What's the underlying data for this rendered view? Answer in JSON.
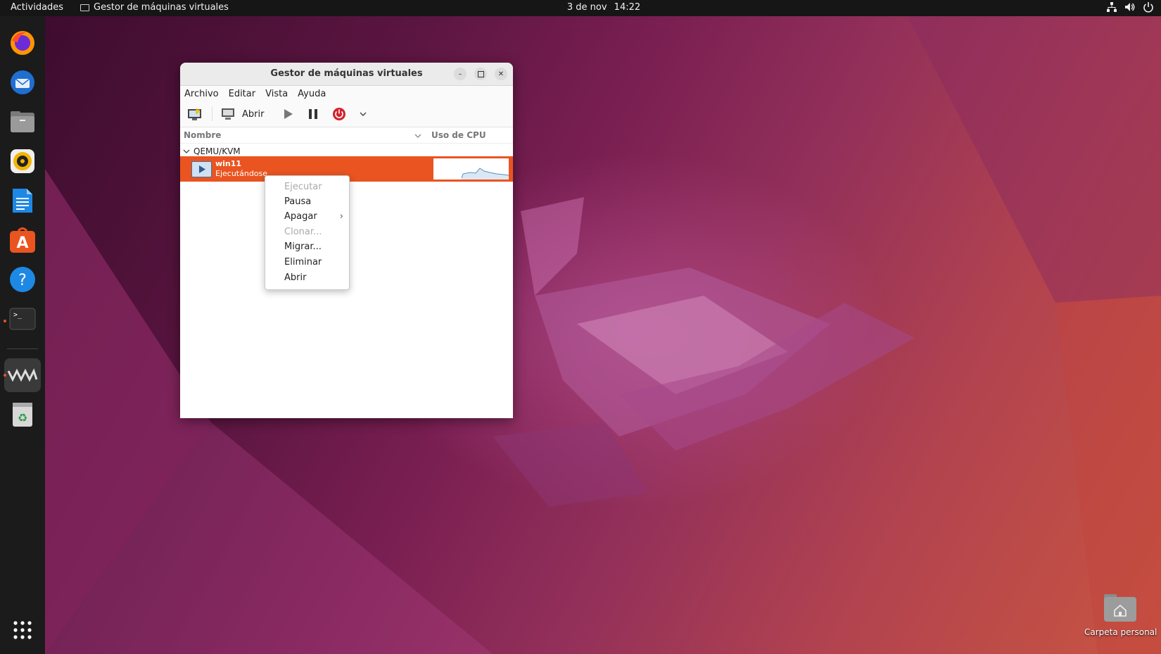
{
  "topbar": {
    "activities": "Actividades",
    "app_name": "Gestor de máquinas virtuales",
    "date": "3 de nov",
    "time": "14:22"
  },
  "dock": {
    "items": [
      "firefox-icon",
      "thunderbird-icon",
      "files-icon",
      "rhythmbox-icon",
      "writer-icon",
      "software-icon",
      "help-icon",
      "terminal-icon",
      "virt-manager-icon",
      "trash-icon",
      "app-grid-icon"
    ]
  },
  "window": {
    "title": "Gestor de máquinas virtuales",
    "menu": [
      "Archivo",
      "Editar",
      "Vista",
      "Ayuda"
    ],
    "toolbar": {
      "open_label": "Abrir"
    },
    "columns": {
      "name": "Nombre",
      "cpu": "Uso de CPU"
    },
    "group": "QEMU/KVM",
    "vm": {
      "name": "win11",
      "status": "Ejecutándose"
    }
  },
  "context_menu": {
    "items": [
      {
        "label": "Ejecutar",
        "enabled": false
      },
      {
        "label": "Pausa",
        "enabled": true
      },
      {
        "label": "Apagar",
        "enabled": true,
        "submenu": true
      },
      {
        "label": "Clonar...",
        "enabled": false
      },
      {
        "label": "Migrar...",
        "enabled": true
      },
      {
        "label": "Eliminar",
        "enabled": true
      },
      {
        "label": "Abrir",
        "enabled": true
      }
    ]
  },
  "desktop": {
    "home_label": "Carpeta personal"
  },
  "colors": {
    "accent": "#e95420",
    "topbar": "#161616",
    "dock": "#1b1b1b"
  }
}
